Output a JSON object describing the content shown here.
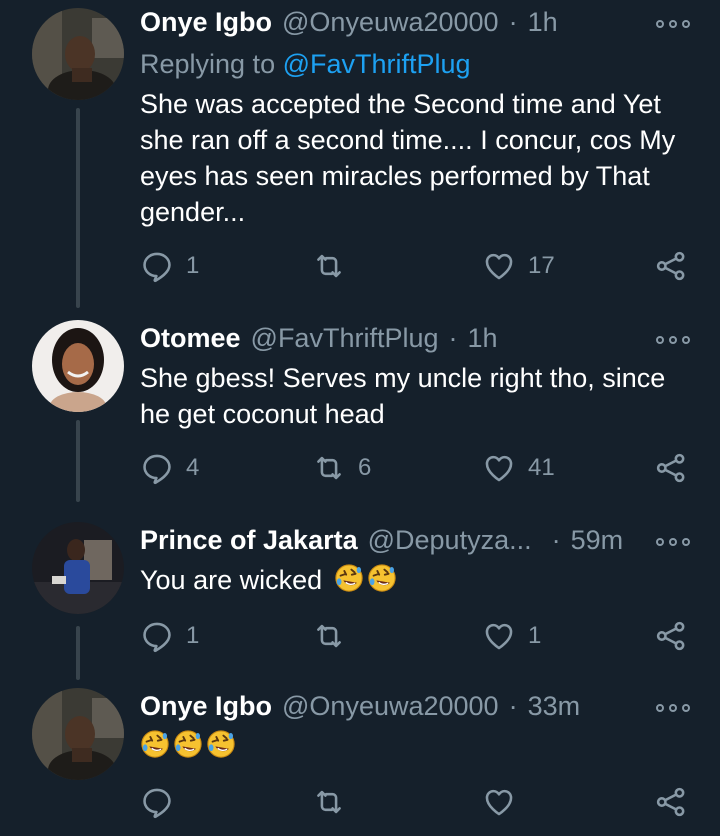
{
  "colors": {
    "background": "#15202b",
    "secondary_text": "#8899a6",
    "link": "#1da1f2",
    "divider": "#38444d"
  },
  "tweets": [
    {
      "name": "Onye Igbo",
      "handle": "@Onyeuwa20000",
      "separator": "·",
      "time": "1h",
      "replying_prefix": "Replying to",
      "replying_to": "@FavThriftPlug",
      "text": "She was accepted the Second time and Yet she ran off a second time.... I concur, cos My eyes has seen miracles performed by That gender...",
      "reply_count": "1",
      "retweet_count": "",
      "like_count": "17"
    },
    {
      "name": "Otomee",
      "handle": "@FavThriftPlug",
      "separator": "·",
      "time": "1h",
      "text": "She gbess! Serves my uncle right tho, since he get coconut head",
      "reply_count": "4",
      "retweet_count": "6",
      "like_count": "41"
    },
    {
      "name": "Prince of Jakarta",
      "handle": "@Deputyza...",
      "separator": "·",
      "time": "59m",
      "text": "You are wicked",
      "emoji": "rolling-on-floor-laughing-emoji",
      "reply_count": "1",
      "retweet_count": "",
      "like_count": "1"
    },
    {
      "name": "Onye Igbo",
      "handle": "@Onyeuwa20000",
      "separator": "·",
      "time": "33m",
      "text": "",
      "emoji": "rolling-on-floor-laughing-emoji",
      "reply_count": "",
      "retweet_count": "",
      "like_count": ""
    }
  ]
}
